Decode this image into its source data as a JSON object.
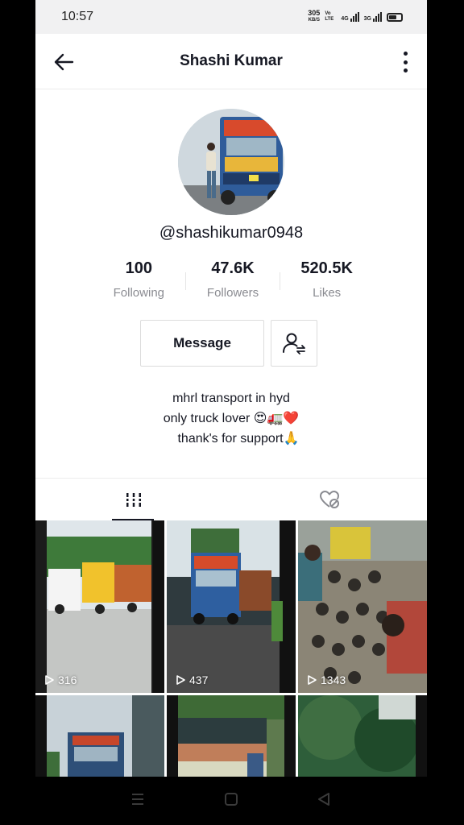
{
  "status": {
    "time": "10:57",
    "speed_value": "305",
    "speed_unit": "KB/S",
    "volte": "Vo LTE",
    "net1": "4G",
    "net2": "3G"
  },
  "header": {
    "title": "Shashi Kumar",
    "back_icon": "arrow-left-icon",
    "more_icon": "more-vertical-icon"
  },
  "profile": {
    "username": "@shashikumar0948",
    "stats": [
      {
        "value": "100",
        "label": "Following"
      },
      {
        "value": "47.6K",
        "label": "Followers"
      },
      {
        "value": "520.5K",
        "label": "Likes"
      }
    ],
    "message_label": "Message",
    "bio": [
      "mhrl transport in hyd",
      "only truck lover 😍🚛❤️",
      "thank's for support🙏"
    ]
  },
  "tabs": [
    {
      "icon": "videos-grid-icon",
      "active": true
    },
    {
      "icon": "liked-heart-hidden-icon",
      "active": false
    }
  ],
  "videos": [
    {
      "views": "316"
    },
    {
      "views": "437"
    },
    {
      "views": "1343"
    },
    {
      "views": ""
    },
    {
      "views": ""
    },
    {
      "views": ""
    }
  ],
  "colors": {
    "text": "#161823",
    "secondary_text": "#8a8b91",
    "border": "#dcdcdc"
  }
}
